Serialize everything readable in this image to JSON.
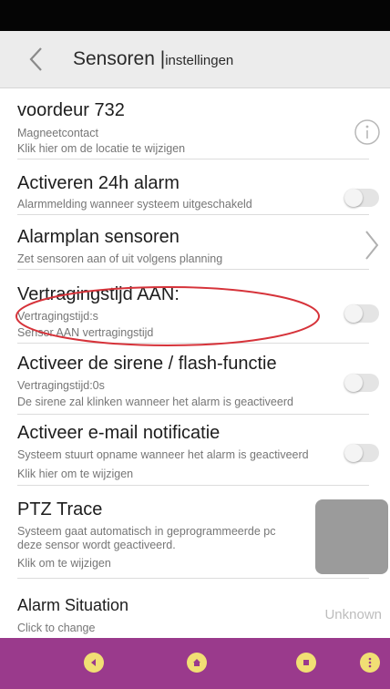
{
  "header": {
    "title": "Sensoren",
    "subtitle": "instellingen"
  },
  "rows": [
    {
      "title": "voordeur 732",
      "line1": "Magneetcontact",
      "line2": "Klik hier om de locatie te wijzigen",
      "control": "info-icon"
    },
    {
      "title": "Activeren 24h alarm",
      "line1": "Alarmmelding wanneer systeem uitgeschakeld",
      "control": "toggle",
      "enabled": false
    },
    {
      "title": "Alarmplan sensoren",
      "line1": "Zet sensoren aan of uit volgens planning",
      "control": "chevron-right-icon"
    },
    {
      "title": "Vertragingstijd AAN:",
      "line1": "Vertragingstijd:s",
      "line2": "Sensor AAN vertragingstijd",
      "control": "toggle",
      "enabled": false,
      "annotation": "red-ellipse"
    },
    {
      "title": "Activeer de sirene / flash-functie",
      "line1": "Vertragingstijd:0s",
      "line2": "De sirene zal klinken wanneer het alarm is geactiveerd",
      "control": "toggle",
      "enabled": false
    },
    {
      "title": "Activeer e-mail notificatie",
      "line1": "Systeem stuurt opname wanneer het alarm is geactiveerd",
      "line2": "Klik hier om te wijzigen",
      "control": "toggle",
      "enabled": false
    },
    {
      "title": "PTZ Trace",
      "line1": "Systeem gaat automatisch in geprogrammeerde pc",
      "line2": "deze sensor wordt geactiveerd.",
      "line3": "Klik om te wijzigen",
      "control": "thumbnail"
    },
    {
      "title": "Alarm Situation",
      "line1": "Click to change",
      "value": "Unknown"
    }
  ],
  "bottom_nav": [
    {
      "icon": "back-icon"
    },
    {
      "icon": "home-icon"
    },
    {
      "icon": "menu-icon"
    },
    {
      "icon": "more-icon"
    }
  ],
  "colors": {
    "status_bar": "#050505",
    "header_bg": "#ececec",
    "bottom_bar": "#9a3a8c",
    "nav_button": "#f1df74",
    "annotation": "#d6333a"
  }
}
